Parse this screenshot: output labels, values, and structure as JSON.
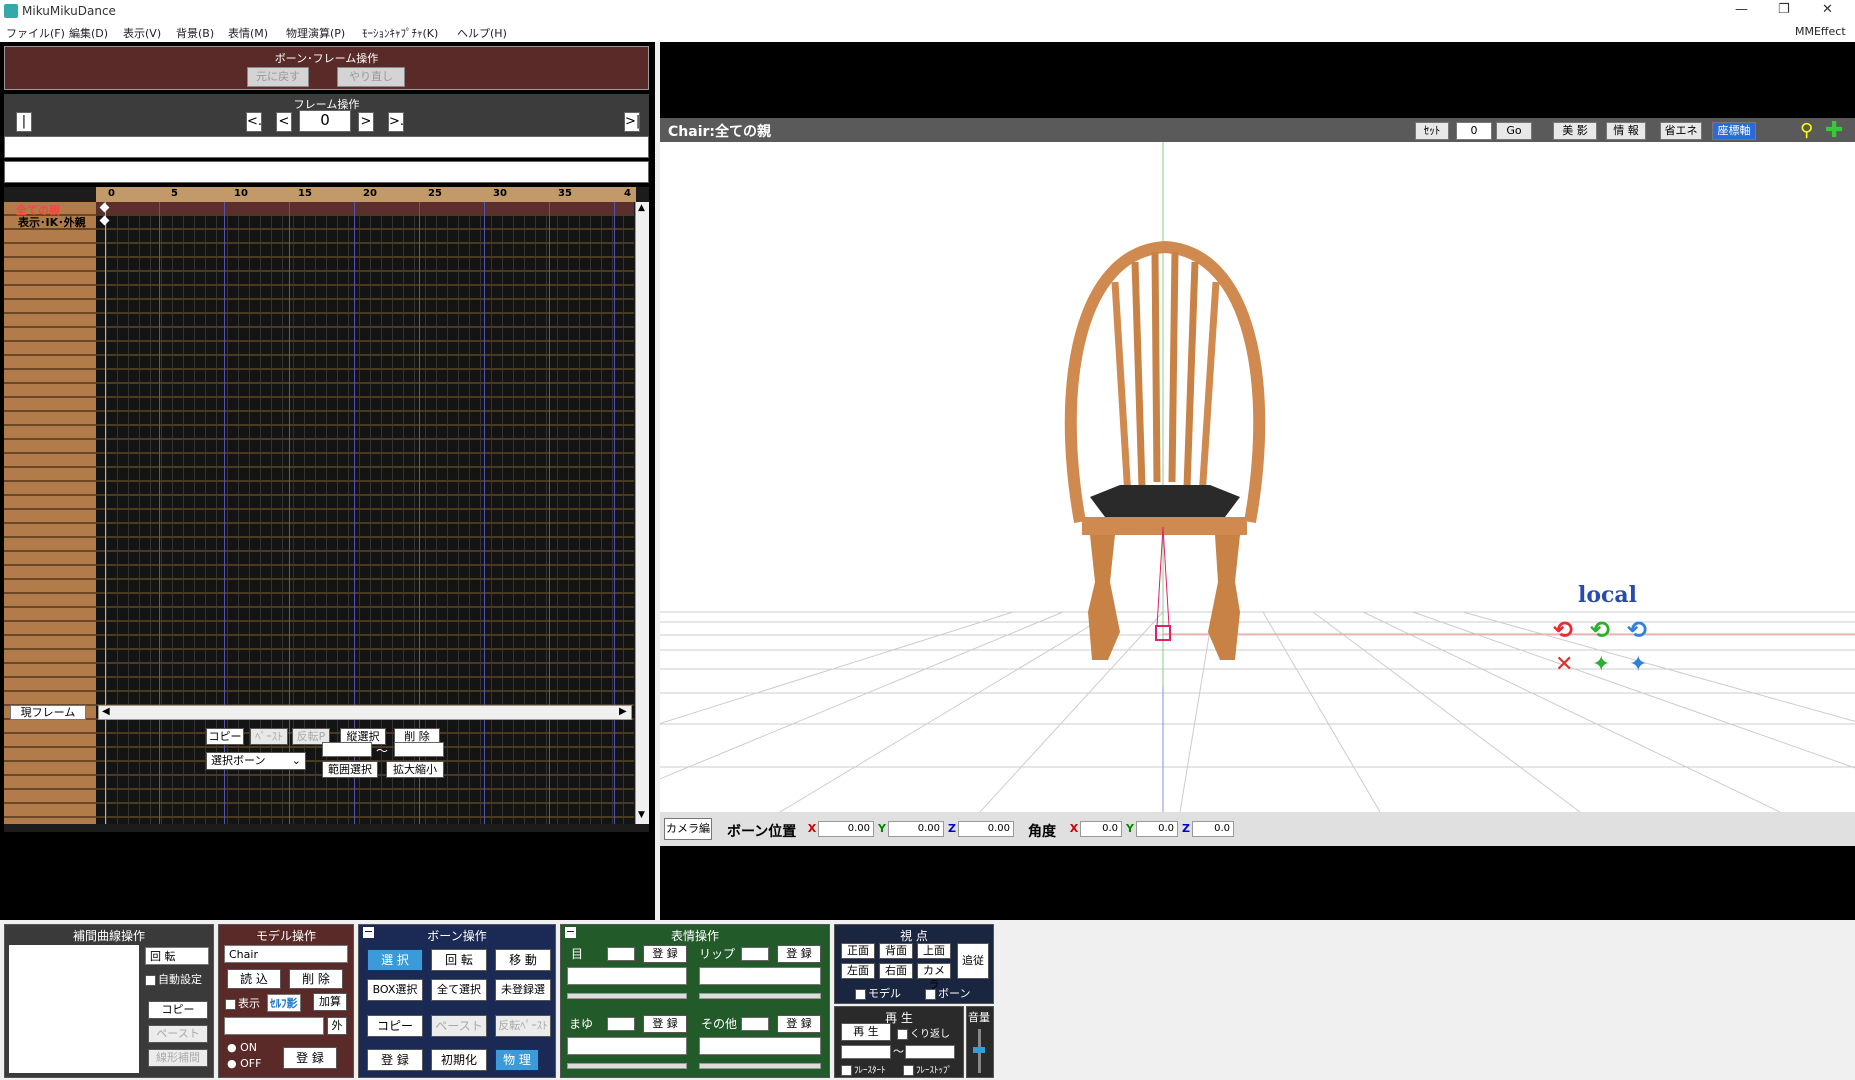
{
  "app": {
    "title": "MikuMikuDance",
    "mmeffect": "MMEffect"
  },
  "menu": [
    "ファイル(F)",
    "編集(D)",
    "表示(V)",
    "背景(B)",
    "表情(M)",
    "物理演算(P)",
    "ﾓｰｼｮﾝｷｬﾌﾟﾁｬ(K)",
    "ヘルプ(H)"
  ],
  "bone_frame_op": {
    "title": "ボーン･フレーム操作",
    "undo": "元に戻す",
    "redo": "やり直し"
  },
  "frame_op": {
    "title": "フレーム操作",
    "current": "0",
    "first": "|<",
    "prev_key": "<.",
    "prev": "<",
    "next": ">",
    "next_key": ">.",
    "last": ">|"
  },
  "timeline": {
    "ruler": [
      "0",
      "5",
      "10",
      "15",
      "20",
      "25",
      "30",
      "35",
      "4"
    ],
    "tracks": [
      "全ての親",
      "表示･IK･外親"
    ],
    "current_frame_label": "現フレーム"
  },
  "frame_buttons": {
    "copy": "コピー",
    "paste": "ﾍﾟｰｽﾄ",
    "flip": "反転P",
    "vsel": "縦選択",
    "delete": "削 除",
    "select_bone": "選択ボーン",
    "tilde": "～",
    "range": "範囲選択",
    "scale": "拡大縮小"
  },
  "viewport": {
    "title": "Chair:全ての親",
    "set": "ｾｯﾄ",
    "set_value": "0",
    "go": "Go",
    "beauty": "美 影",
    "info": "情 報",
    "eco": "省エネ",
    "axis": "座標軸",
    "local": "local"
  },
  "camera_bar": {
    "camera_edit": "カメラ編",
    "pos_label": "ボーン位置",
    "angle_label": "角度",
    "x": "X",
    "y": "Y",
    "z": "Z",
    "pos_x": "0.00",
    "pos_y": "0.00",
    "pos_z": "0.00",
    "ang_x": "0.0",
    "ang_y": "0.0",
    "ang_z": "0.0"
  },
  "interp": {
    "title": "補間曲線操作",
    "mode": "回 転",
    "auto": "自動設定",
    "copy": "コピー",
    "paste": "ペースト",
    "linear": "線形補間"
  },
  "model_op": {
    "title": "モデル操作",
    "model": "Chair",
    "load": "読 込",
    "delete": "削 除",
    "show": "表示",
    "self_shadow": "ｾﾙﾌ影",
    "add": "加算",
    "outer": "外",
    "on": "ON",
    "off": "OFF",
    "register": "登 録"
  },
  "bone_op": {
    "title": "ボーン操作",
    "select": "選 択",
    "rotate": "回 転",
    "move": "移 動",
    "box_select": "BOX選択",
    "select_all": "全て選択",
    "unreg_select": "未登録選",
    "copy": "コピー",
    "paste": "ペースト",
    "flip_paste": "反転ﾍﾟｰｽﾄ",
    "register": "登 録",
    "init": "初期化",
    "physics": "物 理"
  },
  "face_op": {
    "title": "表情操作",
    "eye": "目",
    "lip": "リップ",
    "brow": "まゆ",
    "other": "その他",
    "register": "登 録",
    "prev": "<<",
    "next": ">>"
  },
  "view": {
    "title": "視 点",
    "front": "正面",
    "back": "背面",
    "top": "上面",
    "left": "左面",
    "right": "右面",
    "camera": "カメラ",
    "follow": "追従",
    "model": "モデル",
    "bone": "ボーン"
  },
  "play": {
    "title": "再 生",
    "play": "再 生",
    "repeat": "くり返し",
    "frame_start": "ﾌﾚｰｽﾀｰﾄ",
    "frame_stop": "ﾌﾚｰｽﾄｯﾌﾟ",
    "tilde": "～",
    "volume": "音量"
  }
}
